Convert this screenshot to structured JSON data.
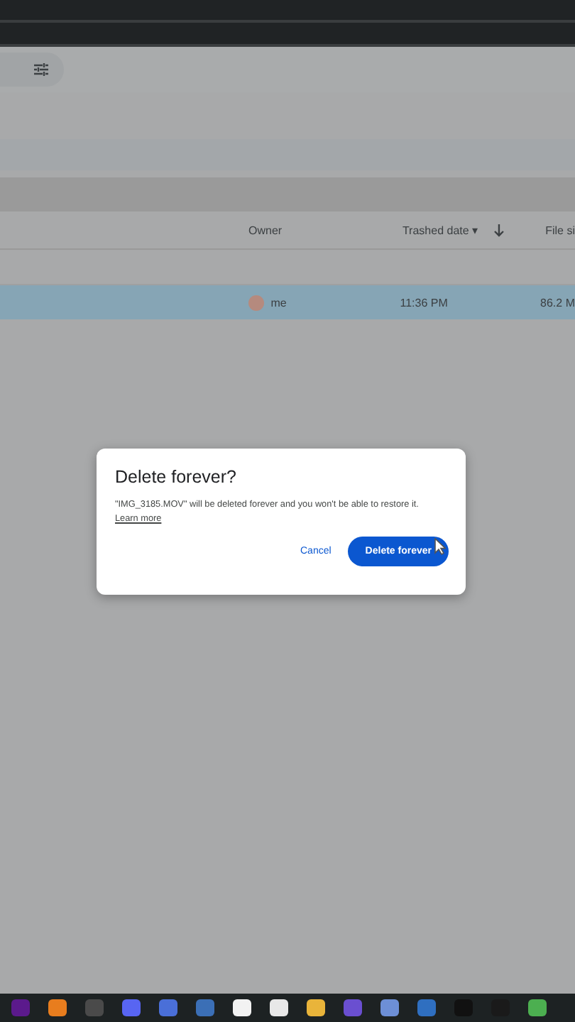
{
  "table": {
    "columns": [
      {
        "label": "Owner",
        "kind": "plain"
      },
      {
        "label": "Trashed date ▾",
        "kind": "sorted"
      },
      {
        "label": "File si",
        "kind": "plain"
      }
    ],
    "rows": [
      {
        "owner": "me",
        "trashed_date": "11:36 PM",
        "file_size": "86.2 M",
        "selected": true
      }
    ]
  },
  "dialog": {
    "title": "Delete forever?",
    "message": "\"IMG_3185.MOV\" will be deleted forever and you won't be able to restore it.",
    "link": "Learn more",
    "buttons": [
      {
        "label": "Cancel",
        "kind": "text"
      },
      {
        "label": "Delete forever",
        "kind": "filled"
      }
    ]
  },
  "taskbar": {
    "apps": [
      {
        "color": "#5b1a8c"
      },
      {
        "color": "#e87d1e"
      },
      {
        "color": "#4a4a4a"
      },
      {
        "color": "#5865f2"
      },
      {
        "color": "#4a6fd8"
      },
      {
        "color": "#3b6fb6"
      },
      {
        "color": "#f2f2f2"
      },
      {
        "color": "#e8e8e8"
      },
      {
        "color": "#e9b43a"
      },
      {
        "color": "#6a4fd0"
      },
      {
        "color": "#6d8fd6"
      },
      {
        "color": "#2f6fc0"
      },
      {
        "color": "#111111"
      },
      {
        "color": "#1a1a1a"
      },
      {
        "color": "#4caf50"
      }
    ]
  }
}
